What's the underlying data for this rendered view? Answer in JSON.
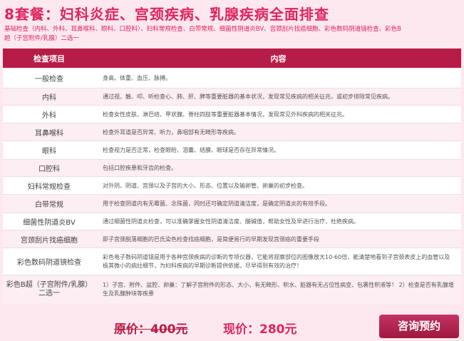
{
  "title": "8套餐：妇科炎症、宫颈疾病、乳腺疾病全面排查",
  "description": "基础检查（内科、外科、耳鼻喉科、眼科、口腔科）、妇科常规检查、白带常规、细菌性阴道炎BV、宫颈刮片找癌细胞、彩色数码阴道镜检查、彩色B超（子宫附件/乳腺）二选一",
  "table": {
    "headers": [
      "检查项目",
      "内容"
    ],
    "rows": [
      {
        "item": "一般检查",
        "content": "身高、体重、血压、脉搏。"
      },
      {
        "item": "内科",
        "content": "通过视、触、叩、听检查心、肺、肝、脾等重要脏器的基本状况，发现常见疾病的相关征兆，或初步排除常见疾病。"
      },
      {
        "item": "外科",
        "content": "检查女性皮肤、淋巴结、甲状腺、脊柱四肢等重要脏器基本情况，发现常见外科疾病的相关征兆。"
      },
      {
        "item": "耳鼻喉科",
        "content": "检查外耳道是否异常、听力，鼻咽部有无畸形等疾病。"
      },
      {
        "item": "眼科",
        "content": "检查视力是否正常，检查眼睑、泪囊、结膜、眼球是否存在异常情况。"
      },
      {
        "item": "口腔科",
        "content": "包括口腔疾患和牙齿的检查。"
      },
      {
        "item": "妇科常规检查",
        "content": "对外阴、阴道、宫颈以及子宫的大小、形态、位置以及输卵管、卵巢的初步检查。"
      },
      {
        "item": "白带常规",
        "content": "用于检查阴道内有无霉菌、念珠菌，同时还可确定阴道清洁度，是确定阴道炎的有效手段。"
      },
      {
        "item": "细菌性阴道炎BV",
        "content": "通过细菌性阴道炎检查，可以准确掌握女性阴道清洁度、酸碱值，帮助女性及早进行治疗，杜绝疾病。"
      },
      {
        "item": "宫颈刮片找癌细胞",
        "content": "即子宫颈脱落细胞的巴氏染色检查找癌细胞，是简便易行的早期发现宫颈癌的重要手段"
      },
      {
        "item": "彩色数码阴道镜检查",
        "content": "彩色电子数码阴道镜是用于各种宫颈疾病的诊断的专项仪器，它能将观察部位的图像放大10-60倍，能清楚地看到子宫颈表皮上的血管以及极其微小的病灶细节，为妇科疾病的早期诊断提供依据，尽早得到有效的治疗！"
      },
      {
        "item": "彩色B超（子宫附件/乳腺）二选一",
        "content": "1）子宫、附件、盆腔、卵巢：了解子宫附件的形态、大小，有无畸形、积水、脏器有无占位性病变、包裹性积液等！ 2）检查是否有乳腺增生及乳腺肿块等疾患"
      }
    ]
  },
  "price": {
    "original": "原价：400元",
    "current": "现价：280元"
  },
  "consult_button": "咨询预约",
  "colors": {
    "accent": "#e0245e",
    "header_bg": "#b71c47",
    "page_bg": "#fde8ef"
  }
}
